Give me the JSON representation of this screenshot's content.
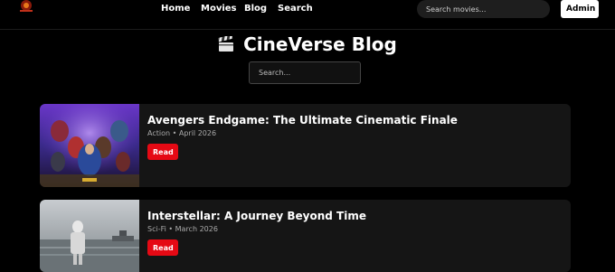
{
  "nav": {
    "home": "Home",
    "movies": "Movies",
    "blog": "Blog",
    "search": "Search",
    "search_placeholder": "Search movies...",
    "admin": "Admin"
  },
  "page": {
    "title": "CineVerse Blog",
    "title_icon": "clapperboard-icon",
    "search_placeholder": "Search..."
  },
  "posts": [
    {
      "title": "Avengers Endgame: The Ultimate Cinematic Finale",
      "meta": "Action • April 2026",
      "button": "Read"
    },
    {
      "title": "Interstellar: A Journey Beyond Time",
      "meta": "Sci-Fi • March 2026",
      "button": "Read"
    }
  ],
  "colors": {
    "accent": "#e50914",
    "background": "#000000",
    "card": "#151515"
  }
}
